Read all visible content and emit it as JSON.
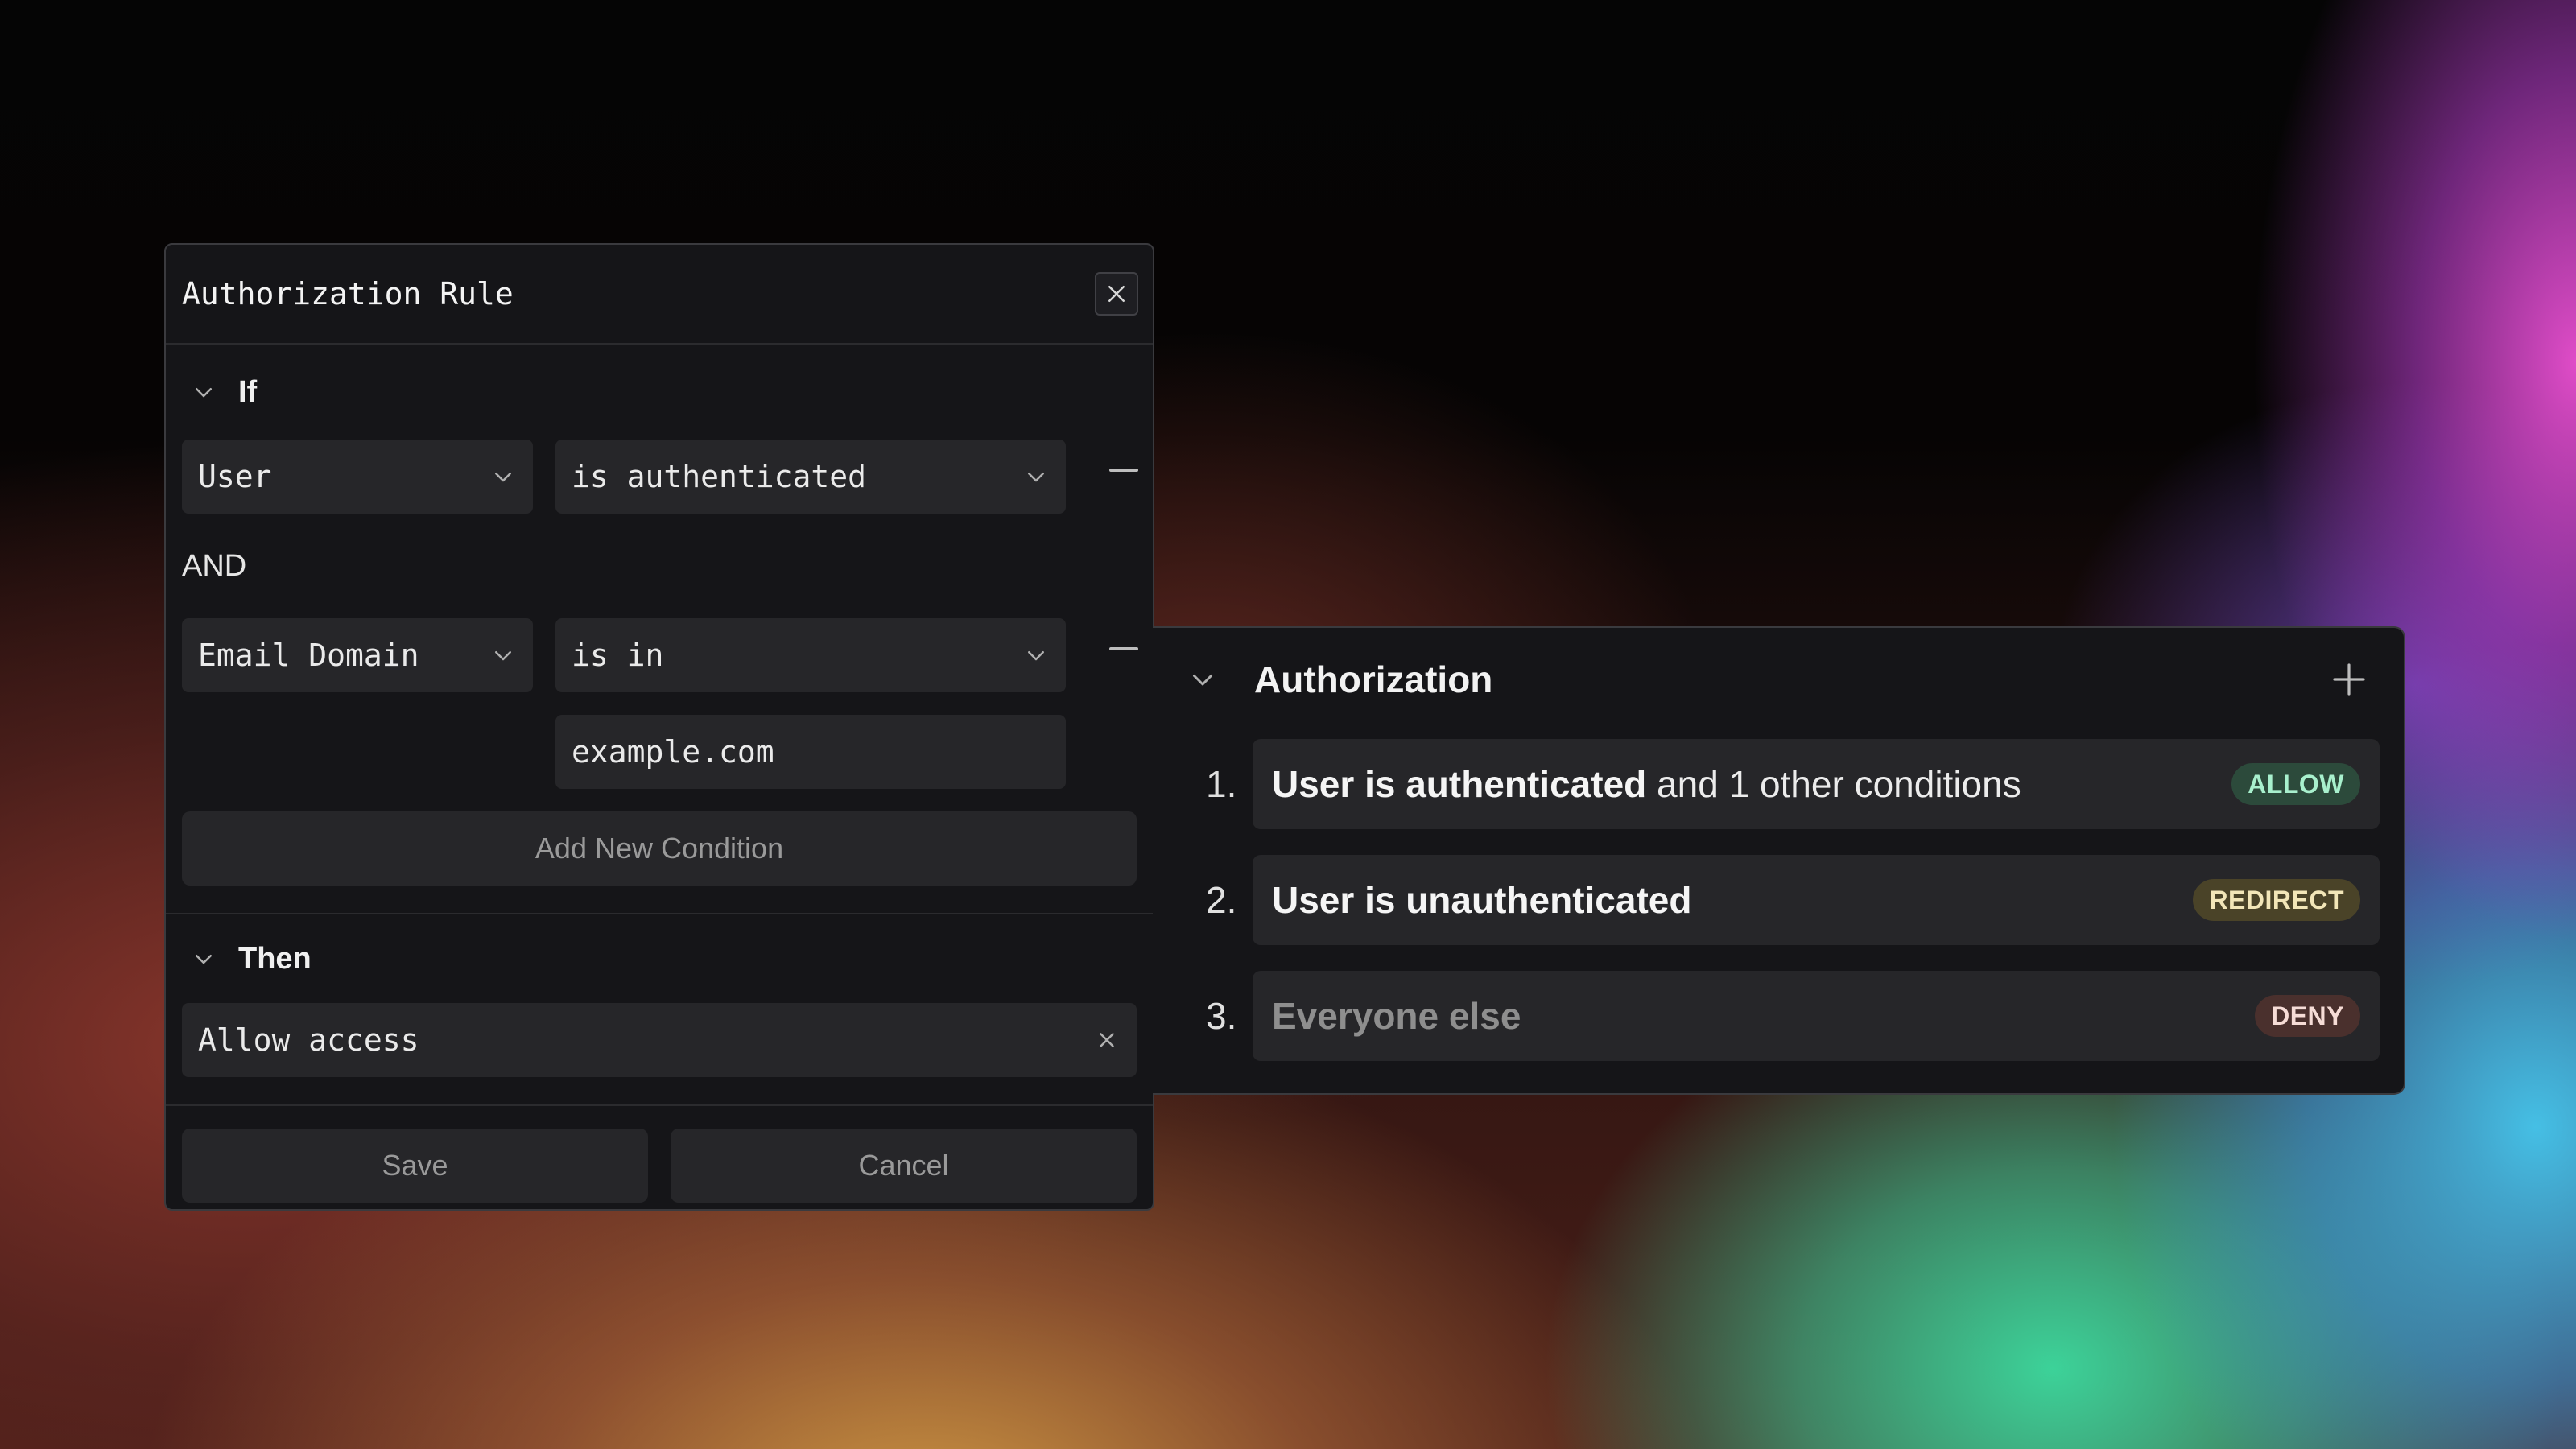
{
  "rule_dialog": {
    "title": "Authorization Rule",
    "if_section": {
      "label": "If",
      "conditions": [
        {
          "field": "User",
          "operator": "is authenticated"
        },
        {
          "field": "Email Domain",
          "operator": "is in",
          "value": "example.com"
        }
      ],
      "joiner": "AND",
      "add_condition_label": "Add New Condition"
    },
    "then_section": {
      "label": "Then",
      "action": "Allow access"
    },
    "save_label": "Save",
    "cancel_label": "Cancel"
  },
  "auth_panel": {
    "title": "Authorization",
    "rules": [
      {
        "number": "1.",
        "bold": "User is authenticated",
        "rest": " and 1 other conditions",
        "badge": "ALLOW"
      },
      {
        "number": "2.",
        "bold": "User is unauthenticated",
        "rest": "",
        "badge": "REDIRECT"
      },
      {
        "number": "3.",
        "muted": "Everyone else",
        "badge": "DENY"
      }
    ]
  },
  "colors": {
    "panel_bg": "#151518",
    "field_bg": "#262629",
    "allow_badge": "#2c4a3b",
    "redirect_badge": "#4a4328",
    "deny_badge": "#4a302d"
  }
}
